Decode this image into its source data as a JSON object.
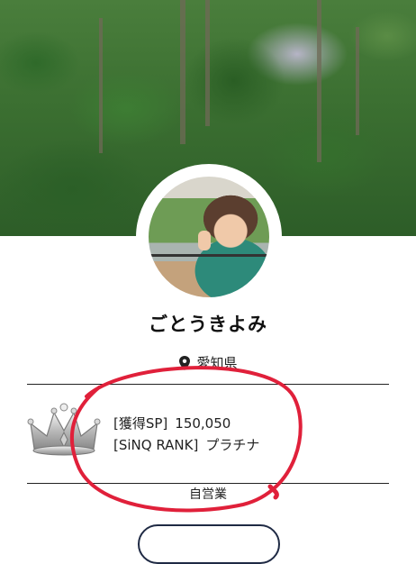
{
  "profile": {
    "name": "ごとうきよみ",
    "location": "愛知県",
    "occupation": "自営業"
  },
  "stats": {
    "sp_label": "[獲得SP]",
    "sp_value": "150,050",
    "rank_label": "[SiNQ RANK]",
    "rank_value": "プラチナ"
  },
  "icons": {
    "location": "map-pin-icon",
    "rank": "crown-icon"
  },
  "colors": {
    "annotation": "#e0203a",
    "divider": "#222222",
    "button_border": "#1f2a44"
  }
}
